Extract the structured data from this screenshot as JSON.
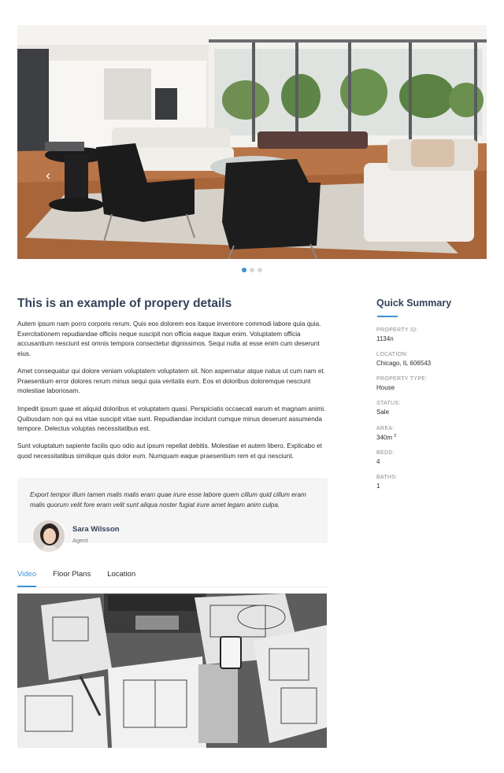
{
  "hero": {
    "prev_icon": "chevron-left-icon",
    "next_icon": "chevron-right-icon",
    "slide_count": 3,
    "active_slide": 1
  },
  "property": {
    "title": "This is an example of propery details",
    "paragraphs": [
      "Autem ipsum nam porro corporis rerum. Quis eos dolorem eos itaque inventore commodi labore quia quia. Exercitationem repudiandae officiis neque suscipit non officia eaque itaque enim. Voluptatem officia accusantium nesciunt est omnis tempora consectetur dignissimos. Sequi nulla at esse enim cum deserunt eius.",
      "Amet consequatur qui dolore veniam voluptatem voluptatem sit. Non aspernatur atque natus ut cum nam et. Praesentium error dolores rerum minus sequi quia veritatis eum. Eos et doloribus doloremque nesciunt molestiae laboriosam.",
      "Impedit ipsum quae et aliquid doloribus et voluptatem quasi. Perspiciatis occaecati earum et magnam animi. Quibusdam non qui ea vitae suscipit vitae sunt. Repudiandae incidunt cumque minus deserunt assumenda tempore. Delectus voluptas necessitatibus est.",
      "Sunt voluptatum sapiente facilis quo odio aut ipsum repellat debitis. Molestiae et autem libero. Explicabo et quod necessitatibus similique quis dolor eum. Numquam eaque praesentium rem et qui nesciunt."
    ]
  },
  "testimonial": {
    "quote": "Export tempor illum tamen malis malis eram quae irure esse labore quem cillum quid cillum eram malis quorum velit fore eram velit sunt aliqua noster fugiat irure amet legam anim culpa.",
    "agent_name": "Sara Wilsson",
    "agent_role": "Agent"
  },
  "tabs": [
    {
      "label": "Video",
      "active": true
    },
    {
      "label": "Floor Plans",
      "active": false
    },
    {
      "label": "Location",
      "active": false
    }
  ],
  "summary": {
    "title": "Quick Summary",
    "fields": [
      {
        "label": "PROPERTY ID:",
        "value": "1134n"
      },
      {
        "label": "LOCATION:",
        "value": "Chicago, IL 606543"
      },
      {
        "label": "PROPERTY TYPE:",
        "value": "House"
      },
      {
        "label": "STATUS:",
        "value": "Sale"
      },
      {
        "label": "AREA:",
        "value": "340m",
        "sup": "2"
      },
      {
        "label": "BEDS:",
        "value": "4"
      },
      {
        "label": "BATHS:",
        "value": "1"
      }
    ]
  },
  "colors": {
    "accent": "#3f8fd6",
    "heading": "#34435a",
    "quote_bg": "#f5f5f5"
  }
}
